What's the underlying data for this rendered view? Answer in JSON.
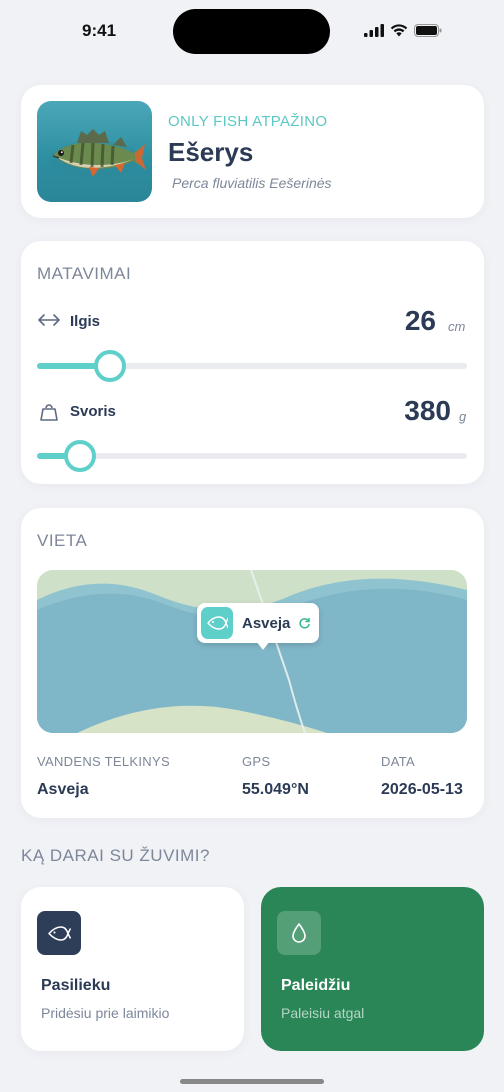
{
  "status": {
    "time": "9:41"
  },
  "fish": {
    "recognized_label": "ONLY FISH ATPAŽINO",
    "name": "Ešerys",
    "latin": "Perca fluviatilis Eešerinės"
  },
  "measurements": {
    "title": "MATAVIMAI",
    "length": {
      "label": "Ilgis",
      "value": "26",
      "unit": "cm",
      "slider_fraction": 0.17
    },
    "weight": {
      "label": "Svoris",
      "value": "380",
      "unit": "g",
      "slider_fraction": 0.1
    }
  },
  "location": {
    "title": "VIETA",
    "pin_label": "Asveja",
    "water_key": "VANDENS TELKINYS",
    "water_val": "Asveja",
    "gps_key": "GPS",
    "gps_val": "55.049°N",
    "date_key": "DATA",
    "date_val": "2026-05-13"
  },
  "question": "KĄ DARAI SU ŽUVIMI?",
  "actions": {
    "keep": {
      "title": "Pasilieku",
      "subtitle": "Pridėsiu prie laimikio",
      "icon": "fish-icon"
    },
    "release": {
      "title": "Paleidžiu",
      "subtitle": "Paleisiu atgal",
      "icon": "water-drop-icon"
    }
  },
  "colors": {
    "accent": "#5fcfc9",
    "release_bg": "#2a8657",
    "text_dark": "#2b3a55",
    "text_muted": "#7d8799"
  }
}
